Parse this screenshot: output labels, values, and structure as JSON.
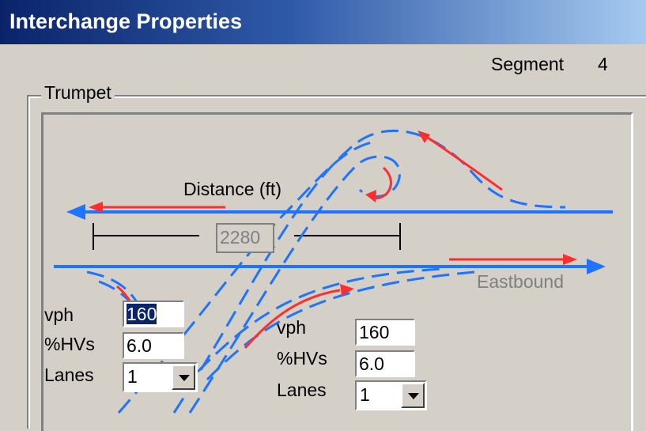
{
  "window": {
    "title": "Interchange Properties"
  },
  "segment": {
    "label": "Segment",
    "value": "4"
  },
  "group": {
    "label": "Trumpet"
  },
  "diagram": {
    "distance_label": "Distance (ft)",
    "distance_value": "2280",
    "eastbound_label": "Eastbound"
  },
  "left_ramp": {
    "vph_label": "vph",
    "vph_value": "160",
    "hv_label": "%HVs",
    "hv_value": "6.0",
    "lanes_label": "Lanes",
    "lanes_value": "1"
  },
  "right_ramp": {
    "vph_label": "vph",
    "vph_value": "160",
    "hv_label": "%HVs",
    "hv_value": "6.0",
    "lanes_label": "Lanes",
    "lanes_value": "1"
  },
  "colors": {
    "road": "#1e73ff",
    "flow": "#ff2d2d",
    "title_start": "#0a246a",
    "title_end": "#a6caf0"
  }
}
